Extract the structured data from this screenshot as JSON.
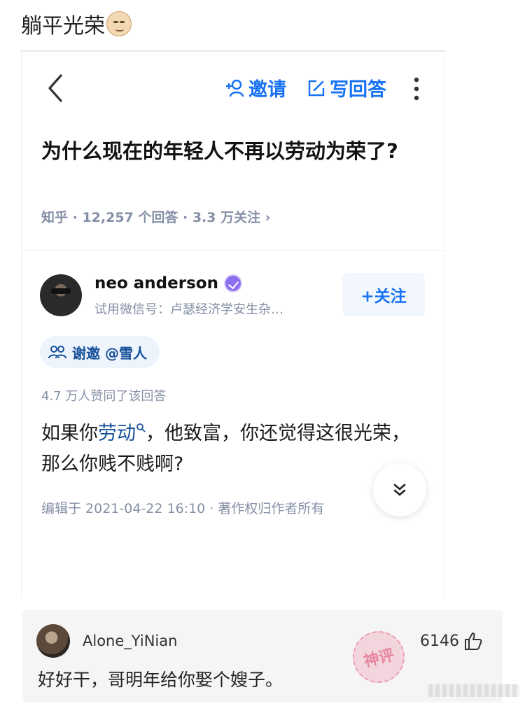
{
  "post": {
    "title": "躺平光荣",
    "emoji": "smirk-face-emoji"
  },
  "header": {
    "invite_label": "邀请",
    "write_label": "写回答",
    "icons": [
      "back-chevron-icon",
      "add-user-icon",
      "edit-icon",
      "more-vertical-icon"
    ]
  },
  "question": {
    "title": "为什么现在的年轻人不再以劳动为荣了?",
    "meta": "知乎 · 12,257 个回答 · 3.3 万关注 ›"
  },
  "author": {
    "name": "neo anderson",
    "subtitle": "试用微信号：卢瑟经济学安生杂…",
    "follow_label": "+关注"
  },
  "thanks": {
    "label": "谢邀 @雪人"
  },
  "answer": {
    "votes": "4.7 万人赞同了该回答",
    "text_before": "如果你",
    "keyword": "劳动",
    "text_after": "，他致富，你还觉得这很光荣，那么你贱不贱啊?",
    "edit_meta": "编辑于 2021-04-22 16:10 · 著作权归作者所有"
  },
  "comment": {
    "user": "Alone_YiNian",
    "likes": "6146",
    "text": "好好干，哥明年给你娶个嫂子。",
    "stamp_text": "神评"
  },
  "colors": {
    "link_blue": "#1772f6",
    "meta_gray": "#8590a6",
    "keyword_blue": "#175199"
  }
}
